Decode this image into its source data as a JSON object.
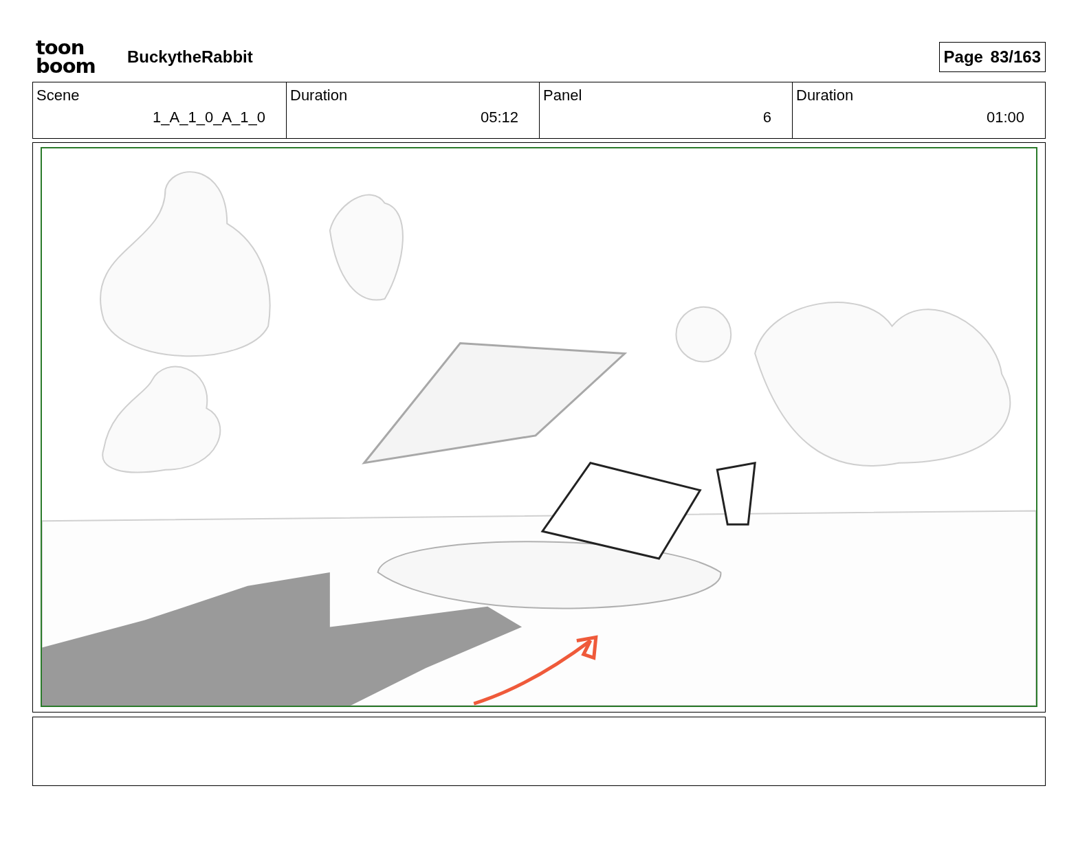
{
  "header": {
    "logo": [
      "toon",
      "boom"
    ],
    "title": "BuckytheRabbit",
    "page": "Page 83/163"
  },
  "info": [
    {
      "label": "Scene",
      "value": "1_A_1_0_A_1_0"
    },
    {
      "label": "Duration",
      "value": "05:12"
    },
    {
      "label": "Panel",
      "value": "6"
    },
    {
      "label": "Duration",
      "value": "01:00"
    }
  ]
}
